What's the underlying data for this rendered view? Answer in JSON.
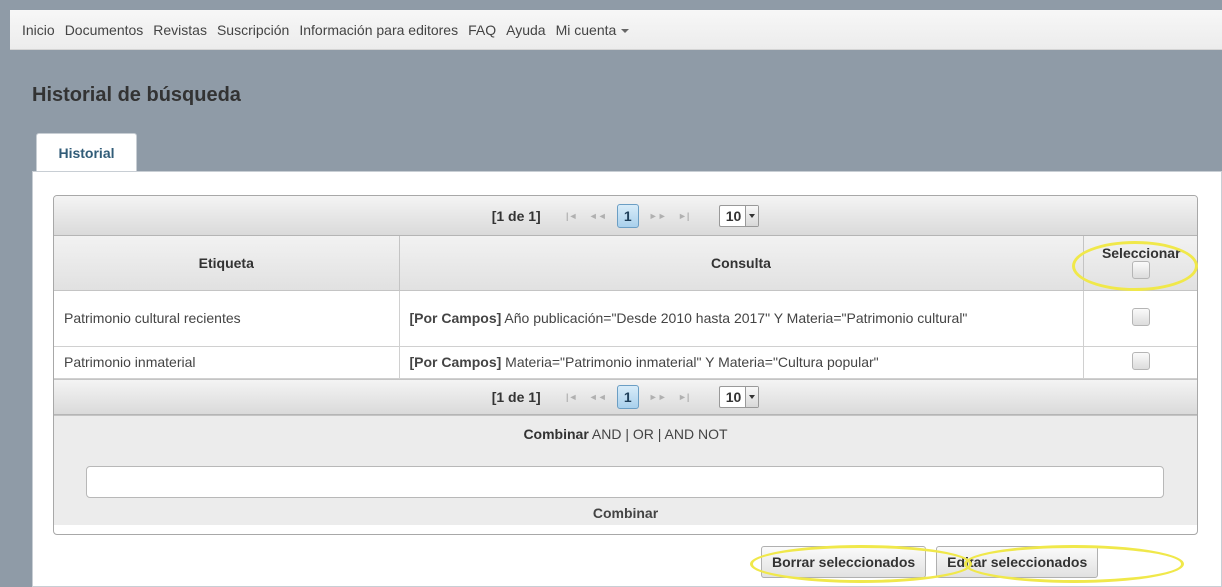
{
  "nav": {
    "items": [
      "Inicio",
      "Documentos",
      "Revistas",
      "Suscripción",
      "Información para editores",
      "FAQ",
      "Ayuda"
    ],
    "account": "Mi cuenta"
  },
  "page": {
    "title": "Historial de búsqueda"
  },
  "tabs": [
    {
      "label": "Historial",
      "active": true
    }
  ],
  "pager": {
    "summary": "[1 de 1]",
    "first_icon": "first-page-icon",
    "prev_icon": "prev-page-icon",
    "current_page": "1",
    "next_icon": "next-page-icon",
    "last_icon": "last-page-icon",
    "page_size": "10"
  },
  "table": {
    "headers": {
      "label": "Etiqueta",
      "query": "Consulta",
      "select": "Seleccionar"
    },
    "rows": [
      {
        "label": "Patrimonio cultural recientes",
        "query_prefix": "[Por Campos]",
        "query": " Año publicación=\"Desde 2010 hasta 2017\" Y Materia=\"Patrimonio cultural\""
      },
      {
        "label": "Patrimonio inmaterial",
        "query_prefix": "[Por Campos]",
        "query": " Materia=\"Patrimonio inmaterial\" Y Materia=\"Cultura popular\""
      }
    ]
  },
  "combine": {
    "label": "Combinar",
    "ops": [
      " AND",
      "OR",
      "AND NOT"
    ],
    "separator": " | ",
    "input_value": "",
    "button": "Combinar"
  },
  "actions": {
    "delete": "Borrar seleccionados",
    "edit": "Editar seleccionados"
  },
  "colors": {
    "background": "#8f9ba7",
    "highlight": "#f0e84a",
    "active_page": "#a9d0ec",
    "tab_text": "#315c78"
  }
}
